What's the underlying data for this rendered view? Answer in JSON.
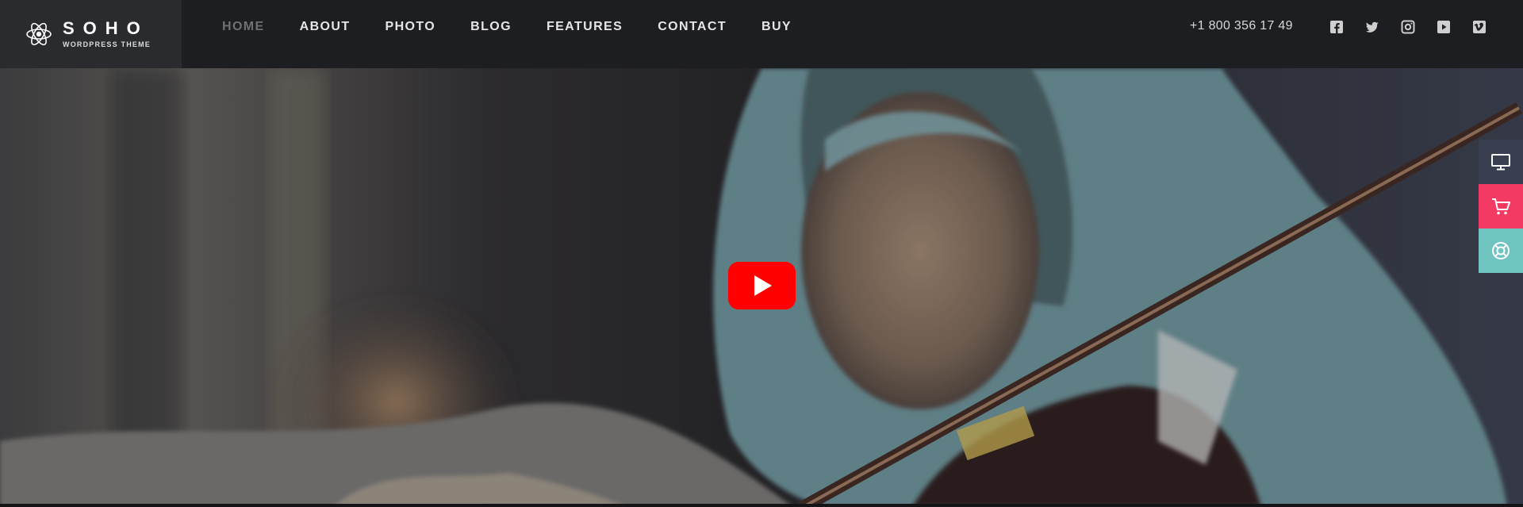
{
  "brand": {
    "name": "SOHO",
    "tagline": "WORDPRESS THEME"
  },
  "nav": {
    "items": [
      {
        "label": "HOME",
        "active": true
      },
      {
        "label": "ABOUT",
        "active": false
      },
      {
        "label": "PHOTO",
        "active": false
      },
      {
        "label": "BLOG",
        "active": false
      },
      {
        "label": "FEATURES",
        "active": false
      },
      {
        "label": "CONTACT",
        "active": false
      },
      {
        "label": "BUY",
        "active": false
      }
    ]
  },
  "header": {
    "phone": "+1 800 356 17 49",
    "socials": [
      "facebook-icon",
      "twitter-icon",
      "instagram-icon",
      "youtube-icon",
      "vimeo-icon"
    ]
  },
  "hero": {
    "media": "video",
    "play_icon": "youtube-play-icon"
  },
  "side_tools": [
    {
      "icon": "monitor-icon",
      "color": "#3a3f4f"
    },
    {
      "icon": "cart-icon",
      "color": "#f23a62"
    },
    {
      "icon": "lifebuoy-icon",
      "color": "#6fc4c0"
    }
  ],
  "colors": {
    "header_bg": "#1d1e21",
    "logo_bg": "#2a2b2f",
    "nav_text": "#e6e6e6",
    "nav_active": "#6f7074",
    "youtube_red": "#ff0000"
  }
}
